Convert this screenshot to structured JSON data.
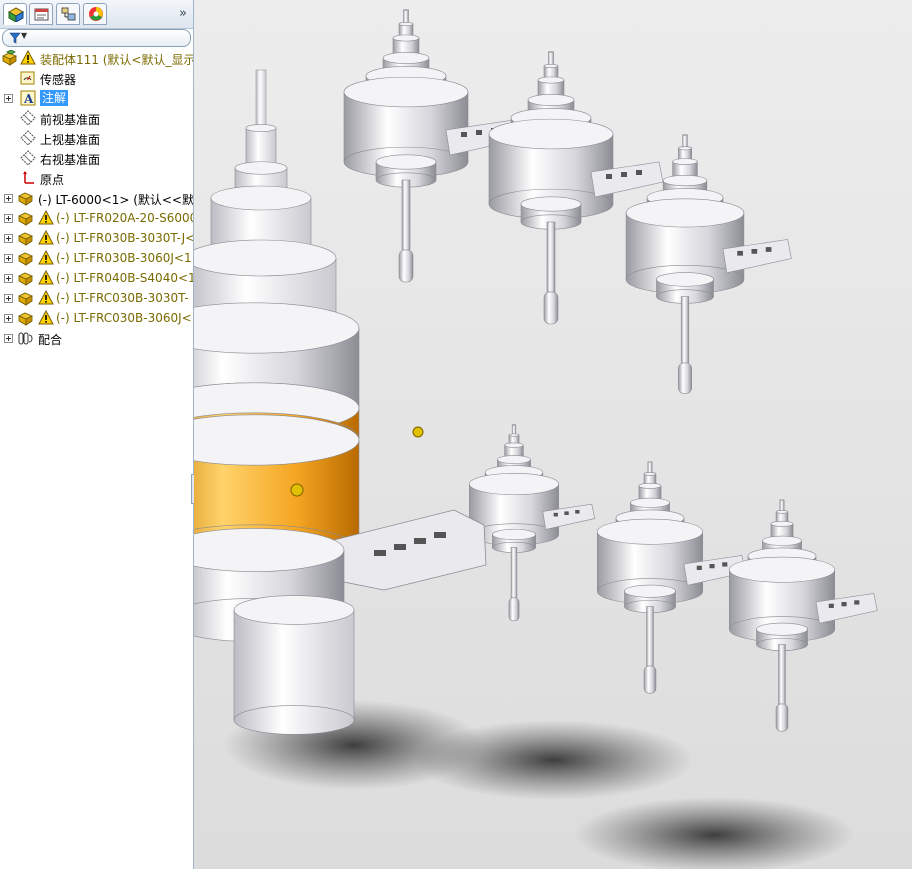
{
  "panel": {
    "tabs": [
      {
        "name": "FeatureManager 设计树",
        "icon": "feature-tree-icon"
      },
      {
        "name": "PropertyManager",
        "icon": "property-manager-icon"
      },
      {
        "name": "ConfigurationManager",
        "icon": "configuration-manager-icon"
      },
      {
        "name": "DisplayManager",
        "icon": "display-manager-icon"
      }
    ],
    "expand_glyph": "»",
    "filter_icon": "funnel-icon"
  },
  "tree": {
    "root": {
      "label": "装配体111  (默认<默认_显示",
      "icon": "assembly-icon",
      "warning": true
    },
    "items": [
      {
        "label": "传感器",
        "icon": "sensor-icon",
        "type": "folder"
      },
      {
        "label": "注解",
        "icon": "annotation-icon",
        "type": "folder",
        "selected": true
      },
      {
        "label": "前视基准面",
        "icon": "plane-icon",
        "type": "plane"
      },
      {
        "label": "上视基准面",
        "icon": "plane-icon",
        "type": "plane"
      },
      {
        "label": "右视基准面",
        "icon": "plane-icon",
        "type": "plane"
      },
      {
        "label": "原点",
        "icon": "origin-icon",
        "type": "origin"
      },
      {
        "label": "(-) LT-6000<1> (默认<<默",
        "icon": "part-icon",
        "type": "part"
      },
      {
        "label": "(-) LT-FR020A-20-S6000",
        "icon": "part-icon",
        "type": "part",
        "warning": true
      },
      {
        "label": "(-) LT-FR030B-3030T-J<",
        "icon": "part-icon",
        "type": "part",
        "warning": true
      },
      {
        "label": "(-) LT-FR030B-3060J<1",
        "icon": "part-icon",
        "type": "part",
        "warning": true
      },
      {
        "label": "(-) LT-FR040B-S4040<1",
        "icon": "part-icon",
        "type": "part",
        "warning": true
      },
      {
        "label": "(-) LT-FRC030B-3030T-",
        "icon": "part-icon",
        "type": "part",
        "warning": true
      },
      {
        "label": "(-) LT-FRC030B-3060J<",
        "icon": "part-icon",
        "type": "part",
        "warning": true
      },
      {
        "label": "配合",
        "icon": "mates-icon",
        "type": "mates"
      }
    ]
  },
  "colors": {
    "selection": "#3399ff",
    "warning_text": "#7a6b00",
    "accent_orange": "#f5a623",
    "part_silver": "#d8d8dc"
  }
}
